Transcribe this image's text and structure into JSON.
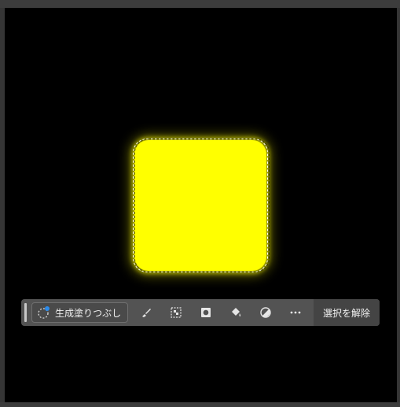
{
  "canvas": {
    "background": "#000000",
    "shape_color": "#ffff00"
  },
  "taskbar": {
    "generative_fill_label": "生成塗りつぶし",
    "deselect_label": "選択を解除",
    "icons": [
      "brush-icon",
      "pixel-select-icon",
      "mask-icon",
      "paint-bucket-icon",
      "adjustment-icon",
      "more-icon"
    ]
  }
}
